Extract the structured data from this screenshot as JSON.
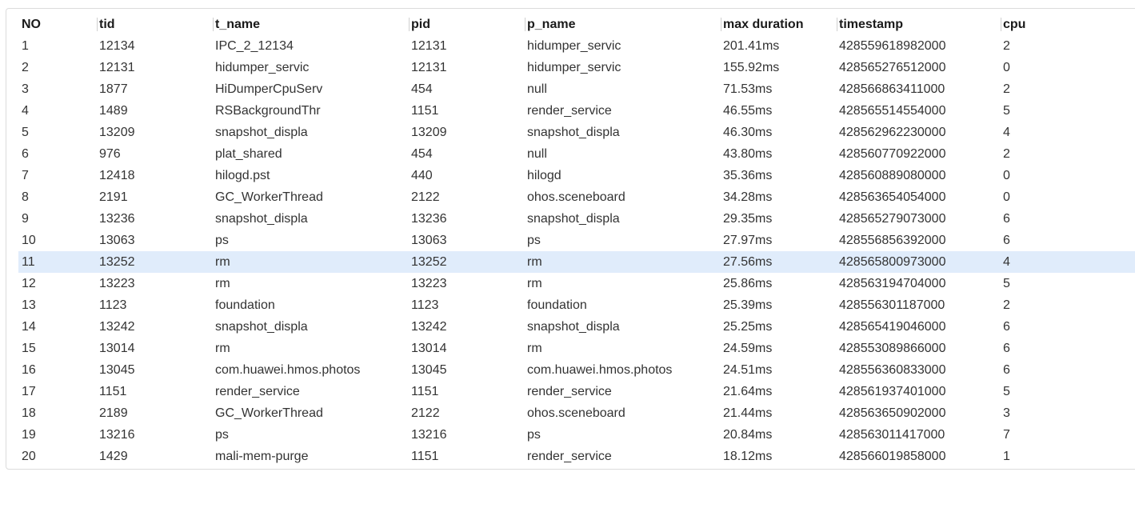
{
  "table": {
    "columns": [
      "NO",
      "tid",
      "t_name",
      "pid",
      "p_name",
      "max duration",
      "timestamp",
      "cpu"
    ],
    "selected_row_index": 10,
    "rows": [
      [
        "1",
        "12134",
        "IPC_2_12134",
        "12131",
        "hidumper_servic",
        "201.41ms",
        "428559618982000",
        "2"
      ],
      [
        "2",
        "12131",
        "hidumper_servic",
        "12131",
        "hidumper_servic",
        "155.92ms",
        "428565276512000",
        "0"
      ],
      [
        "3",
        "1877",
        "HiDumperCpuServ",
        "454",
        "null",
        "71.53ms",
        "428566863411000",
        "2"
      ],
      [
        "4",
        "1489",
        "RSBackgroundThr",
        "1151",
        "render_service",
        "46.55ms",
        "428565514554000",
        "5"
      ],
      [
        "5",
        "13209",
        "snapshot_displa",
        "13209",
        "snapshot_displa",
        "46.30ms",
        "428562962230000",
        "4"
      ],
      [
        "6",
        "976",
        "plat_shared",
        "454",
        "null",
        "43.80ms",
        "428560770922000",
        "2"
      ],
      [
        "7",
        "12418",
        "hilogd.pst",
        "440",
        "hilogd",
        "35.36ms",
        "428560889080000",
        "0"
      ],
      [
        "8",
        "2191",
        "GC_WorkerThread",
        "2122",
        "ohos.sceneboard",
        "34.28ms",
        "428563654054000",
        "0"
      ],
      [
        "9",
        "13236",
        "snapshot_displa",
        "13236",
        "snapshot_displa",
        "29.35ms",
        "428565279073000",
        "6"
      ],
      [
        "10",
        "13063",
        "ps",
        "13063",
        "ps",
        "27.97ms",
        "428556856392000",
        "6"
      ],
      [
        "11",
        "13252",
        "rm",
        "13252",
        "rm",
        "27.56ms",
        "428565800973000",
        "4"
      ],
      [
        "12",
        "13223",
        "rm",
        "13223",
        "rm",
        "25.86ms",
        "428563194704000",
        "5"
      ],
      [
        "13",
        "1123",
        "foundation",
        "1123",
        "foundation",
        "25.39ms",
        "428556301187000",
        "2"
      ],
      [
        "14",
        "13242",
        "snapshot_displa",
        "13242",
        "snapshot_displa",
        "25.25ms",
        "428565419046000",
        "6"
      ],
      [
        "15",
        "13014",
        "rm",
        "13014",
        "rm",
        "24.59ms",
        "428553089866000",
        "6"
      ],
      [
        "16",
        "13045",
        "com.huawei.hmos.photos",
        "13045",
        "com.huawei.hmos.photos",
        "24.51ms",
        "428556360833000",
        "6"
      ],
      [
        "17",
        "1151",
        "render_service",
        "1151",
        "render_service",
        "21.64ms",
        "428561937401000",
        "5"
      ],
      [
        "18",
        "2189",
        "GC_WorkerThread",
        "2122",
        "ohos.sceneboard",
        "21.44ms",
        "428563650902000",
        "3"
      ],
      [
        "19",
        "13216",
        "ps",
        "13216",
        "ps",
        "20.84ms",
        "428563011417000",
        "7"
      ],
      [
        "20",
        "1429",
        "mali-mem-purge",
        "1151",
        "render_service",
        "18.12ms",
        "428566019858000",
        "1"
      ]
    ]
  },
  "colors": {
    "selected_row_bg": "#e0ecfb",
    "header_divider": "#d0d0d0",
    "panel_border": "#dcdcdc"
  }
}
